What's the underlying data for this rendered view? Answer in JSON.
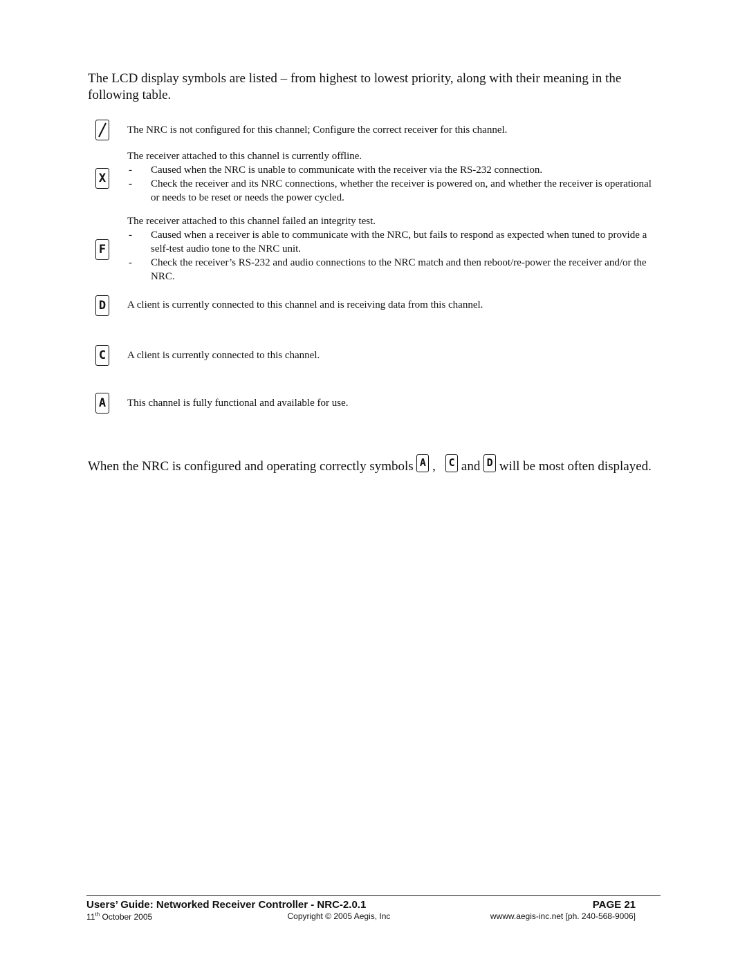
{
  "intro": "The LCD display symbols are listed – from highest to lowest priority, along with their meaning in the following table.",
  "symbols": [
    {
      "icon": "slash-symbol-icon",
      "glyph": "/",
      "heading": "The NRC is not configured for this channel; Configure the correct receiver for this channel.",
      "bullets": []
    },
    {
      "icon": "x-symbol-icon",
      "glyph": "X",
      "heading": "The receiver attached to this channel is currently offline.",
      "bullets": [
        "Caused when the NRC is unable to communicate with the receiver via the RS-232 connection.",
        "Check the receiver and its NRC connections, whether the receiver is powered on, and whether the receiver is operational or needs to be reset or needs the power cycled."
      ]
    },
    {
      "icon": "f-symbol-icon",
      "glyph": "F",
      "heading": "The receiver attached to this channel failed an integrity test.",
      "bullets": [
        "Caused when a receiver is able to communicate with the NRC, but fails to respond as expected when tuned to provide a self-test audio tone to the NRC unit.",
        "Check the receiver’s RS-232 and audio connections to the NRC match and then reboot/re-power the receiver and/or the NRC."
      ]
    },
    {
      "icon": "d-symbol-icon",
      "glyph": "D",
      "heading": "A client is currently connected to this channel and is receiving data from this channel.",
      "bullets": []
    },
    {
      "icon": "c-symbol-icon",
      "glyph": "C",
      "heading": "A client is currently connected to this channel.",
      "bullets": []
    },
    {
      "icon": "a-symbol-icon",
      "glyph": "A",
      "heading": "This channel is fully functional and available for use.",
      "bullets": []
    }
  ],
  "bullet_dash": "-",
  "outro": {
    "part1": "When the NRC is configured and operating correctly symbols",
    "glyph_a": "A",
    "sep1": ",",
    "glyph_c": "C",
    "sep2": "and",
    "glyph_d": "D",
    "part2": "will be most often displayed."
  },
  "footer": {
    "title": "Users’ Guide: Networked Receiver Controller - NRC-2.0.1",
    "page": "PAGE 21",
    "date_day": "11",
    "date_suffix": "th",
    "date_rest": " October 2005",
    "copyright": "Copyright © 2005 Aegis, Inc",
    "website": "wwww.aegis-inc.net [ph. 240-568-9006]"
  }
}
